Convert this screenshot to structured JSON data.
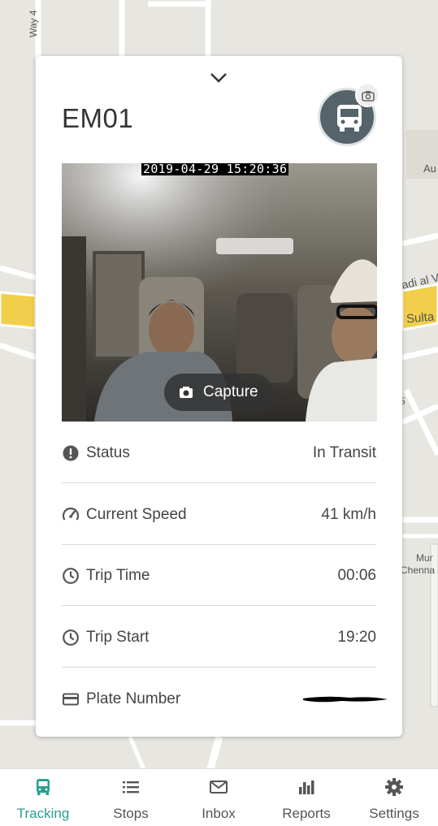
{
  "map": {
    "labels": {
      "way": "Way 4",
      "au": "Au",
      "adi": "adi al V",
      "sulta": "Sulta",
      "mur": "Mur",
      "chenna": "Chenna",
      "five": "5"
    }
  },
  "card": {
    "vehicle_title": "EM01",
    "snapshot": {
      "timestamp": "2019-04-29 15:20:36",
      "capture_label": "Capture"
    },
    "rows": {
      "status": {
        "label": "Status",
        "value": "In Transit",
        "icon": "exclamation-circle-icon"
      },
      "speed": {
        "label": "Current Speed",
        "value": "41 km/h",
        "icon": "speedometer-icon"
      },
      "trip_time": {
        "label": "Trip Time",
        "value": "00:06",
        "icon": "clock-icon"
      },
      "trip_start": {
        "label": "Trip Start",
        "value": "19:20",
        "icon": "clock-icon"
      },
      "plate": {
        "label": "Plate Number",
        "icon": "credit-card-icon"
      }
    }
  },
  "bottom_nav": {
    "tracking": "Tracking",
    "stops": "Stops",
    "inbox": "Inbox",
    "reports": "Reports",
    "settings": "Settings"
  },
  "colors": {
    "accent": "#2a9d8f",
    "avatar_bg": "#55636a",
    "road_yellow": "#f2cf4a"
  }
}
